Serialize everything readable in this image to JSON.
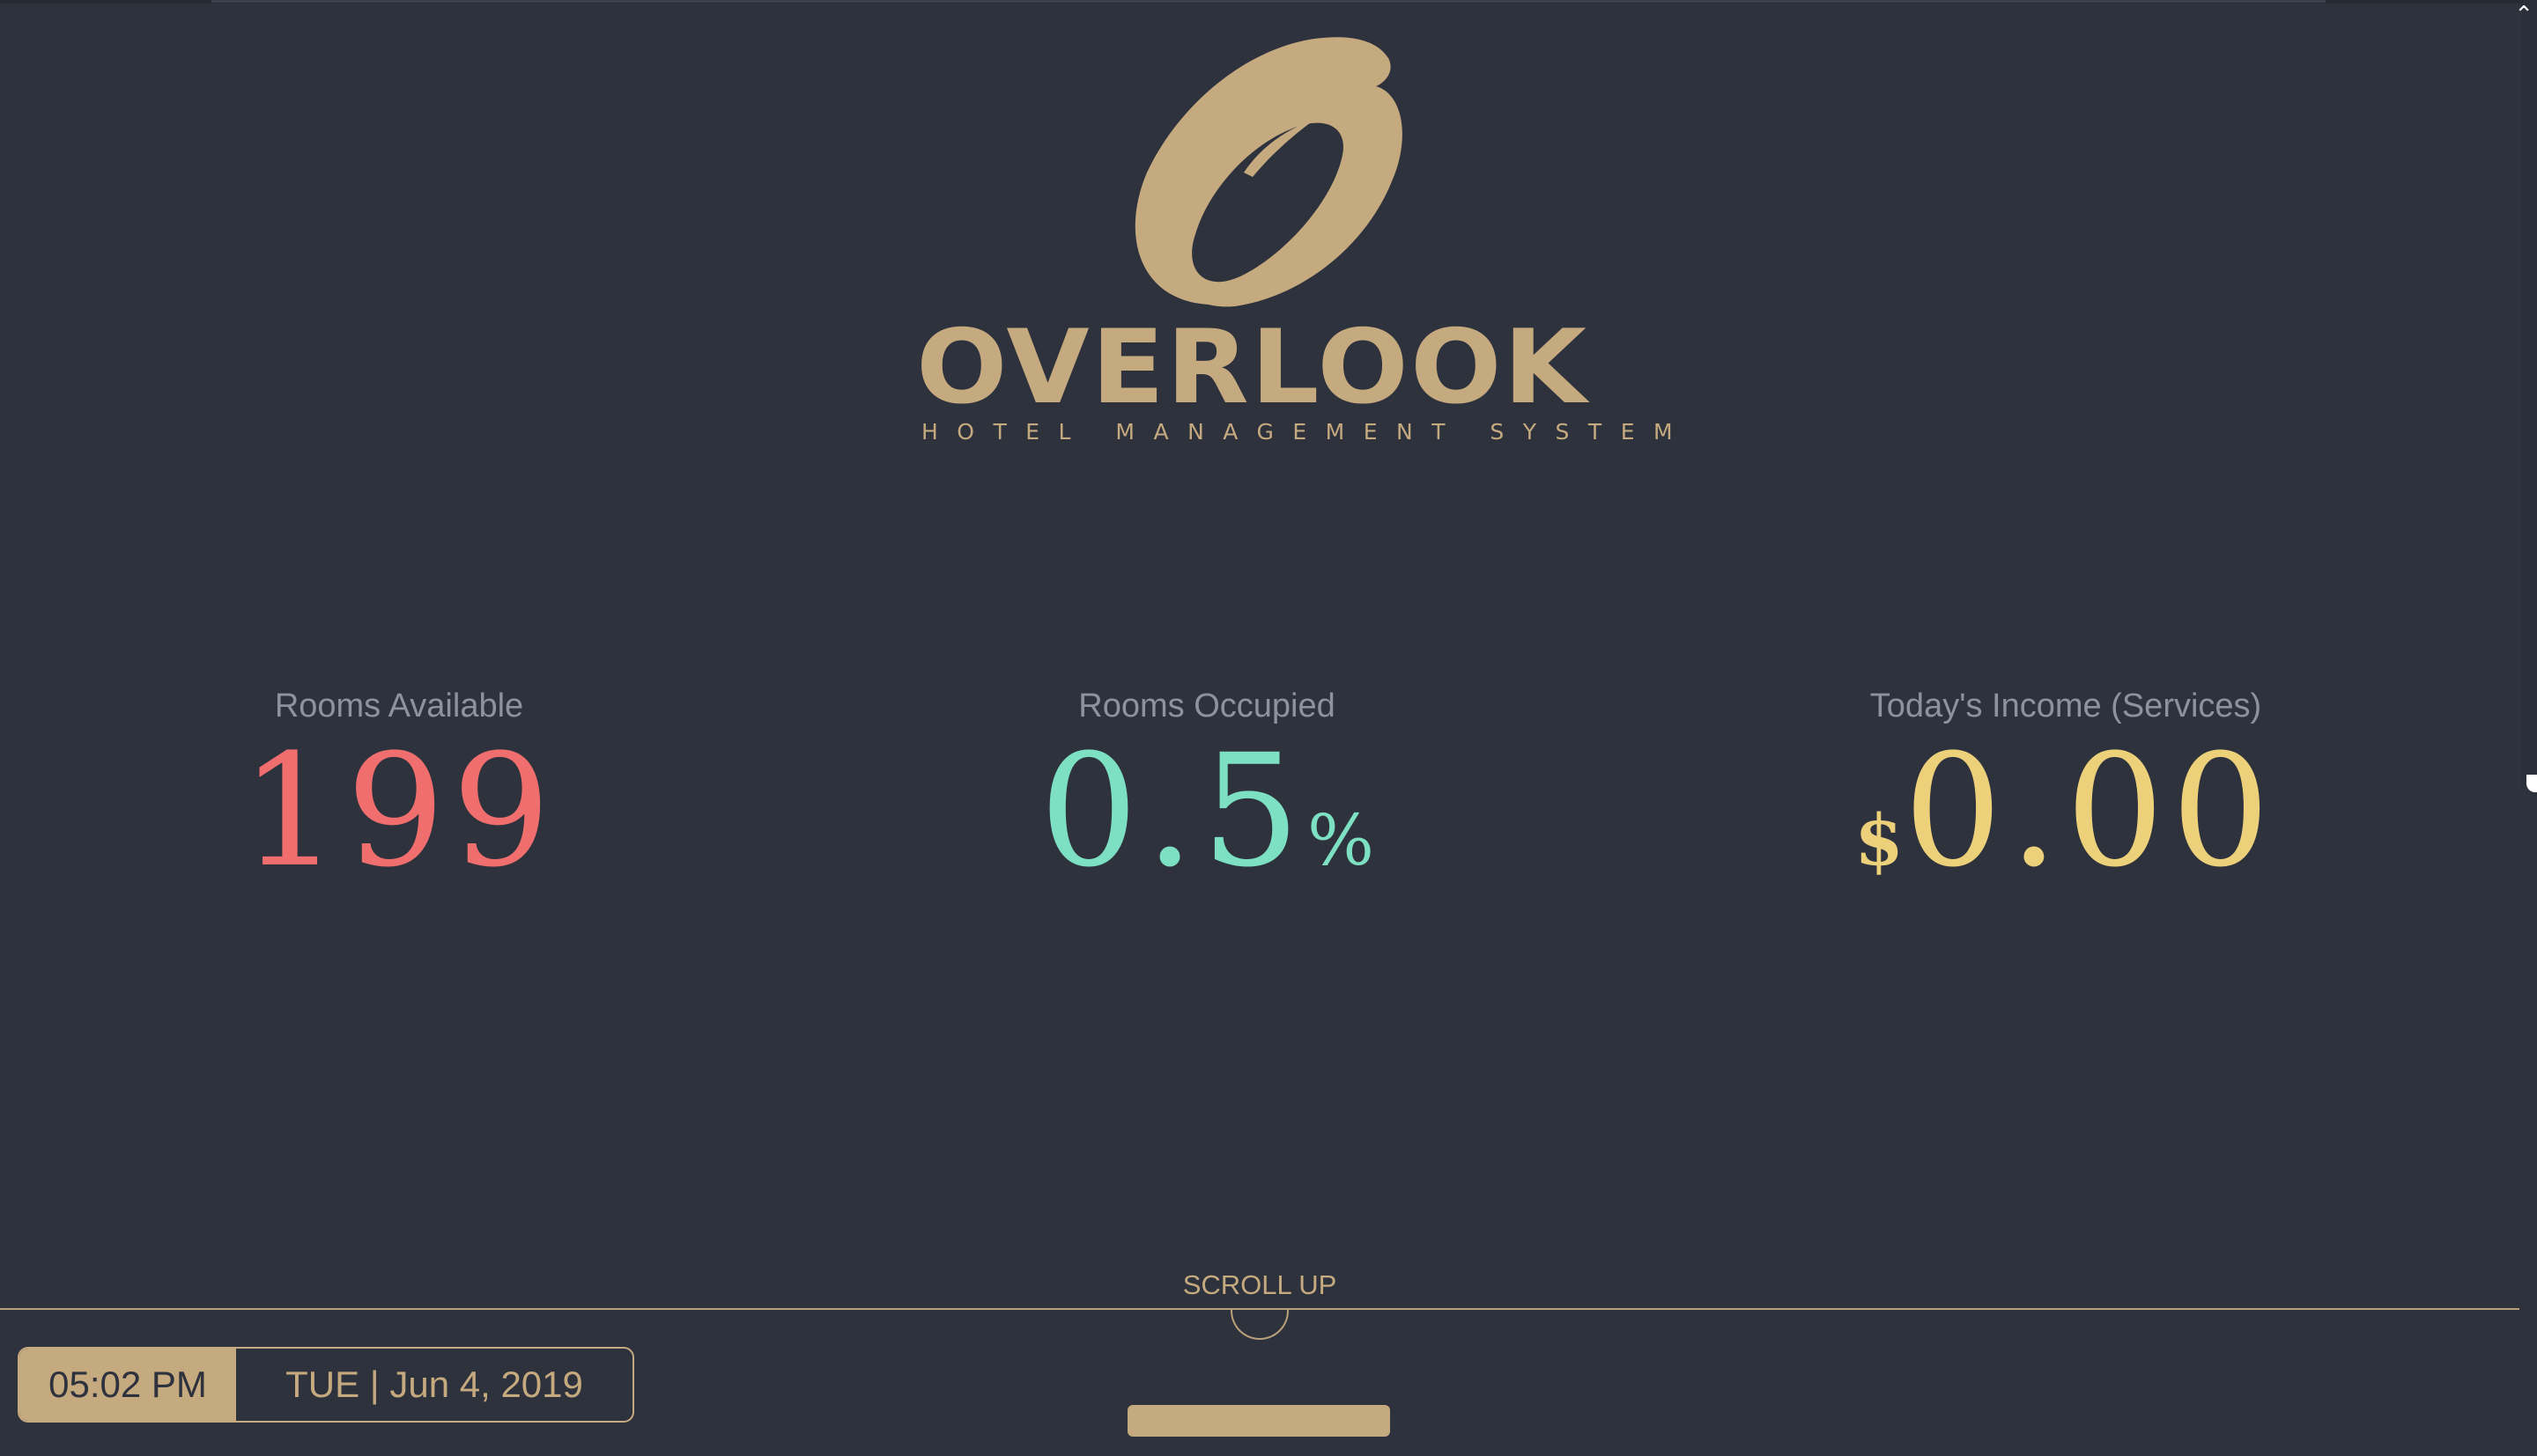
{
  "brand": {
    "name": "OVERLOOK",
    "tagline": "HOTEL MANAGEMENT SYSTEM",
    "color": "#c5a97f"
  },
  "stats": {
    "rooms_available": {
      "label": "Rooms Available",
      "value": "199",
      "color": "#f06e6e"
    },
    "rooms_occupied": {
      "label": "Rooms Occupied",
      "value": "0.5",
      "suffix": "%",
      "color": "#7de0c2"
    },
    "todays_income": {
      "label": "Today's Income (Services)",
      "prefix": "$",
      "value": "0.00",
      "color": "#ecd07a"
    }
  },
  "footer": {
    "scroll_up_label": "SCROLL UP",
    "time": "05:02 PM",
    "date": "TUE | Jun 4, 2019"
  },
  "colors": {
    "background": "#2e323d",
    "accent": "#c5a97f",
    "label_text": "#8e929c"
  }
}
